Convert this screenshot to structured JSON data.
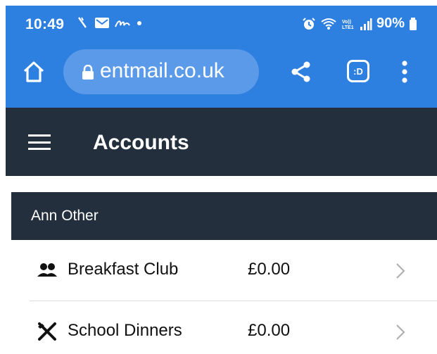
{
  "status_bar": {
    "time": "10:49",
    "battery": "90%"
  },
  "browser": {
    "url": "entmail.co.uk",
    "tab_switcher_label": ":D"
  },
  "app": {
    "title": "Accounts"
  },
  "account": {
    "name": "Ann Other",
    "items": [
      {
        "label": "Breakfast Club",
        "amount": "£0.00",
        "icon": "people-icon"
      },
      {
        "label": "School Dinners",
        "amount": "£0.00",
        "icon": "cutlery-icon"
      }
    ]
  },
  "colors": {
    "browser_blue": "#2d7fe0",
    "url_bar": "#5b9ae8",
    "app_bar": "#232f3c"
  }
}
